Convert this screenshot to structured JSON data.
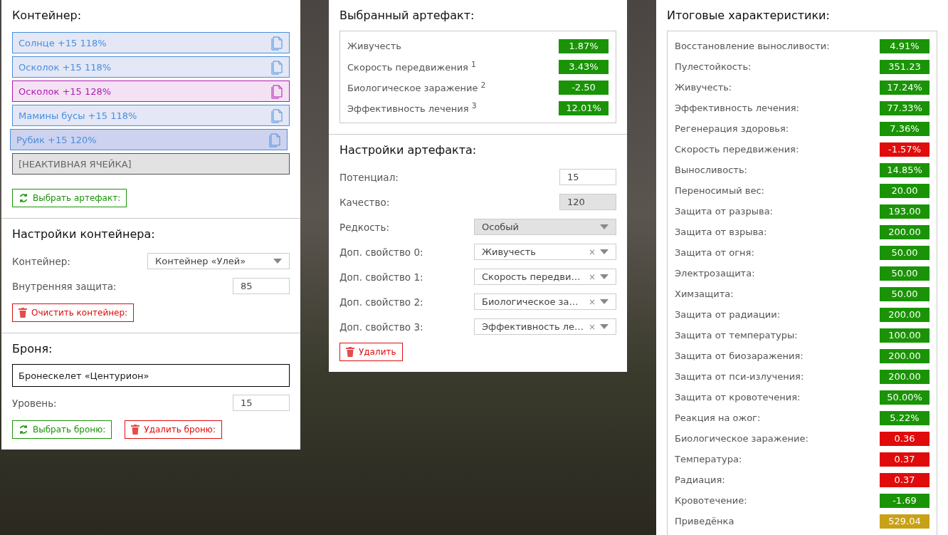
{
  "container": {
    "title": "Контейнер:",
    "slots": [
      {
        "kind": "artifact",
        "label": "Солнце +15 118%",
        "color": "#4a8fe0",
        "selected": false
      },
      {
        "kind": "artifact",
        "label": "Осколок +15 118%",
        "color": "#4a8fe0",
        "selected": false
      },
      {
        "kind": "artifact",
        "label": "Осколок +15 128%",
        "color": "#b01ab0",
        "selected": false
      },
      {
        "kind": "artifact",
        "label": "Мамины бусы +15 118%",
        "color": "#4a8fe0",
        "selected": false
      },
      {
        "kind": "artifact",
        "label": "Рубик +15 120%",
        "color": "#4a8fe0",
        "selected": true
      },
      {
        "kind": "empty",
        "label": "[НЕАКТИВНАЯ ЯЧЕЙКА]"
      }
    ],
    "pick_button": "Выбрать артефакт:"
  },
  "container_settings": {
    "title": "Настройки контейнера:",
    "container_label": "Контейнер:",
    "container_value": "Контейнер «Улей»",
    "protection_label": "Внутренняя защита:",
    "protection_value": "85",
    "clear_button": "Очистить контейнер:"
  },
  "armor": {
    "title": "Броня:",
    "name": "Бронескелет «Центурион»",
    "level_label": "Уровень:",
    "level_value": "15",
    "pick_button": "Выбрать броню:",
    "delete_button": "Удалить броню:"
  },
  "selected_artifact": {
    "title": "Выбранный артефакт:",
    "stats": [
      {
        "label": "Живучесть",
        "value": "1.87%",
        "color": "#1a9406"
      },
      {
        "label": "Скорость передвижения $^{1}$",
        "value": "3.43%",
        "color": "#1a9406"
      },
      {
        "label": "Биологическое заражение $^{2}$",
        "value": "-2.50",
        "color": "#1a9406"
      },
      {
        "label": "Эффективность лечения $^{3}$",
        "value": "12.01%",
        "color": "#1a9406"
      }
    ]
  },
  "artifact_settings": {
    "title": "Настройки артефакта:",
    "fields": [
      {
        "kind": "input",
        "label": "Потенциал:",
        "value": "15",
        "disabled": false
      },
      {
        "kind": "input",
        "label": "Качество:",
        "value": "120",
        "disabled": true
      },
      {
        "kind": "select",
        "label": "Редкость:",
        "value": "Особый",
        "disabled": true
      },
      {
        "kind": "select",
        "label": "Доп. свойство 0:",
        "value": "Живучесть",
        "disabled": false,
        "clear_icon": "×"
      },
      {
        "kind": "select",
        "label": "Доп. свойство 1:",
        "value": "Скорость передви…",
        "disabled": false,
        "clear_icon": "×"
      },
      {
        "kind": "select",
        "label": "Доп. свойство 2:",
        "value": "Биологическое за…",
        "disabled": false,
        "clear_icon": "×"
      },
      {
        "kind": "select",
        "label": "Доп. свойство 3:",
        "value": "Эффективность ле…",
        "disabled": false,
        "clear_icon": "×"
      }
    ],
    "delete_button": "Удалить"
  },
  "totals": {
    "title": "Итоговые характеристики:",
    "stats": [
      {
        "label": "Восстановление выносливости:",
        "value": "4.91%",
        "color": "#1a9406"
      },
      {
        "label": "Пулестойкость:",
        "value": "351.23",
        "color": "#1a9406"
      },
      {
        "label": "Живучесть:",
        "value": "17.24%",
        "color": "#1a9406"
      },
      {
        "label": "Эффективность лечения:",
        "value": "77.33%",
        "color": "#1a9406"
      },
      {
        "label": "Регенерация здоровья:",
        "value": "7.36%",
        "color": "#1a9406"
      },
      {
        "label": "Скорость передвижения:",
        "value": "-1.57%",
        "color": "#e00c0c"
      },
      {
        "label": "Выносливость:",
        "value": "14.85%",
        "color": "#1a9406"
      },
      {
        "label": "Переносимый вес:",
        "value": "20.00",
        "color": "#1a9406"
      },
      {
        "label": "Защита от разрыва:",
        "value": "193.00",
        "color": "#1a9406"
      },
      {
        "label": "Защита от взрыва:",
        "value": "200.00",
        "color": "#1a9406"
      },
      {
        "label": "Защита от огня:",
        "value": "50.00",
        "color": "#1a9406"
      },
      {
        "label": "Электрозащита:",
        "value": "50.00",
        "color": "#1a9406"
      },
      {
        "label": "Химзащита:",
        "value": "50.00",
        "color": "#1a9406"
      },
      {
        "label": "Защита от радиации:",
        "value": "200.00",
        "color": "#1a9406"
      },
      {
        "label": "Защита от температуры:",
        "value": "100.00",
        "color": "#1a9406"
      },
      {
        "label": "Защита от биозаражения:",
        "value": "200.00",
        "color": "#1a9406"
      },
      {
        "label": "Защита от пси-излучения:",
        "value": "200.00",
        "color": "#1a9406"
      },
      {
        "label": "Защита от кровотечения:",
        "value": "50.00%",
        "color": "#1a9406"
      },
      {
        "label": "Реакция на ожог:",
        "value": "5.22%",
        "color": "#1a9406"
      },
      {
        "label": "Биологическое заражение:",
        "value": "0.36",
        "color": "#e00c0c"
      },
      {
        "label": "Температура:",
        "value": "0.37",
        "color": "#e00c0c"
      },
      {
        "label": "Радиация:",
        "value": "0.37",
        "color": "#e00c0c"
      },
      {
        "label": "Кровотечение:",
        "value": "-1.69",
        "color": "#1a9406"
      },
      {
        "label": "Приведёнка",
        "value": "529.04",
        "color": "#c9a117"
      }
    ]
  }
}
